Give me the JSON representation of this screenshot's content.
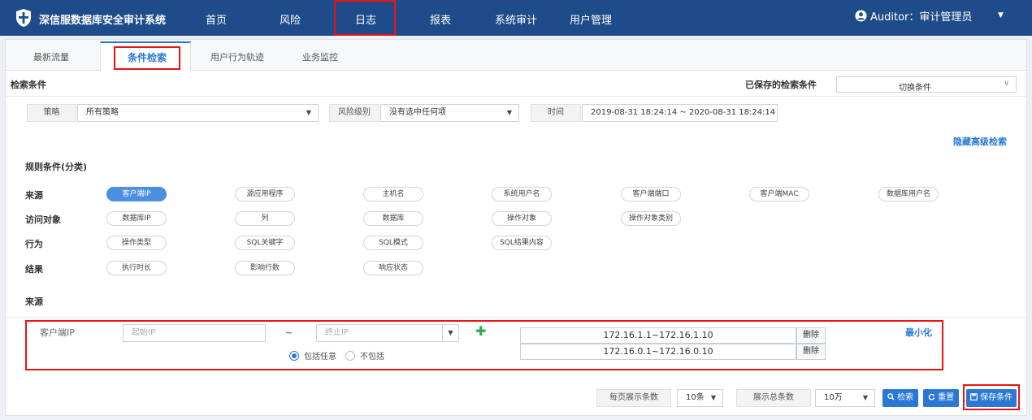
{
  "header": {
    "brand": "深信服数据库安全审计系统",
    "nav": [
      "首页",
      "风险",
      "日志",
      "报表",
      "系统审计",
      "用户管理"
    ],
    "active_nav": "日志",
    "user": "Auditor：审计管理员"
  },
  "tabs": [
    "最新流量",
    "条件检索",
    "用户行为轨迹",
    "业务监控"
  ],
  "active_tab": "条件检索",
  "search": {
    "title": "检索条件",
    "saved_label": "已保存的检索条件",
    "saved_select": "切换条件",
    "policy_label": "策略",
    "policy_value": "所有策略",
    "risk_label": "风险级别",
    "risk_value": "没有选中任何项",
    "time_label": "时间",
    "time_value": "2019-08-31 18:24:14 ~ 2020-08-31 18:24:14",
    "hide_advanced": "隐藏高级检索"
  },
  "rules": {
    "title": "规则条件(分类)",
    "groups": [
      {
        "label": "来源",
        "items": [
          "客户端IP",
          "源应用程序",
          "主机名",
          "系统用户名",
          "客户端端口",
          "客户端MAC",
          "数据库用户名"
        ]
      },
      {
        "label": "访问对象",
        "items": [
          "数据库IP",
          "列",
          "数据库",
          "操作对象",
          "操作对象类别"
        ]
      },
      {
        "label": "行为",
        "items": [
          "操作类型",
          "SQL关键字",
          "SQL模式",
          "SQL结果内容"
        ]
      },
      {
        "label": "结果",
        "items": [
          "执行时长",
          "影响行数",
          "响应状态"
        ]
      }
    ],
    "active_item": "客户端IP"
  },
  "source": {
    "title": "来源",
    "field_label": "客户端IP",
    "start_placeholder": "起始IP",
    "tilde": "~",
    "end_placeholder": "终止IP",
    "radio_include": "包括任意",
    "radio_exclude": "不包括",
    "ranges": [
      "172.16.1.1~172.16.1.10",
      "172.16.0.1~172.16.0.10"
    ],
    "delete_label": "删除",
    "minimize": "最小化"
  },
  "footer": {
    "per_page_label": "每页展示条数",
    "per_page_value": "10条",
    "total_label": "展示总条数",
    "total_value": "10万",
    "search_btn": "检索",
    "reset_btn": "重置",
    "save_btn": "保存条件"
  }
}
